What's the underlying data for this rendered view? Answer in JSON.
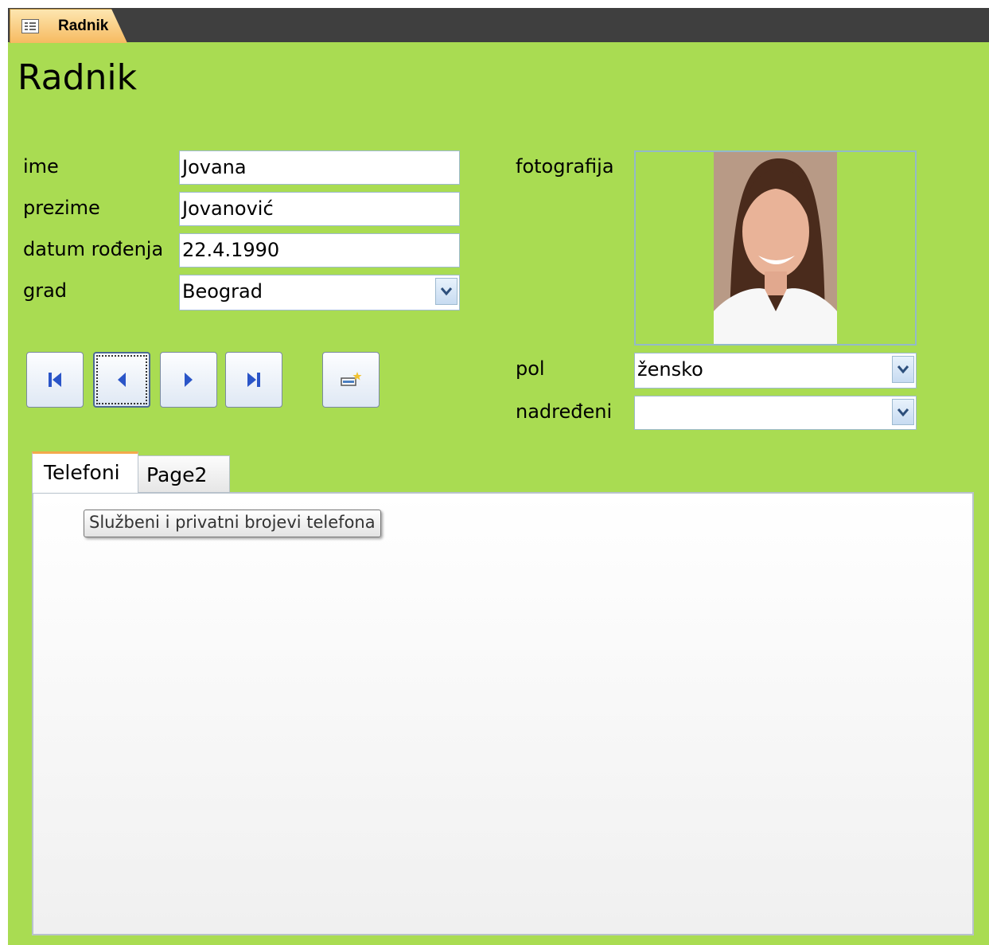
{
  "document_tab": {
    "label": "Radnik",
    "icon": "form-icon"
  },
  "form": {
    "title": "Radnik",
    "fields": {
      "ime": {
        "label": "ime",
        "value": "Jovana"
      },
      "prezime": {
        "label": "prezime",
        "value": "Jovanović"
      },
      "datum_rodjenja": {
        "label": "datum rođenja",
        "value": "22.4.1990"
      },
      "grad": {
        "label": "grad",
        "value": "Beograd"
      },
      "fotografija": {
        "label": "fotografija"
      },
      "pol": {
        "label": "pol",
        "value": "žensko"
      },
      "nadredjeni": {
        "label": "nadređeni",
        "value": ""
      }
    },
    "nav_buttons": [
      "first-record-icon",
      "previous-record-icon",
      "next-record-icon",
      "last-record-icon",
      "new-record-icon"
    ]
  },
  "tab_control": {
    "tabs": [
      {
        "label": "Telefoni",
        "active": true
      },
      {
        "label": "Page2",
        "active": false
      }
    ],
    "tooltip": "Službeni i privatni brojevi telefona"
  },
  "colors": {
    "form_background": "#a9dc52",
    "tab_strip": "#3f3f3f",
    "document_tab": "#f6b95f",
    "field_border": "#9ebad0",
    "active_tab_accent": "#f3a94b"
  }
}
